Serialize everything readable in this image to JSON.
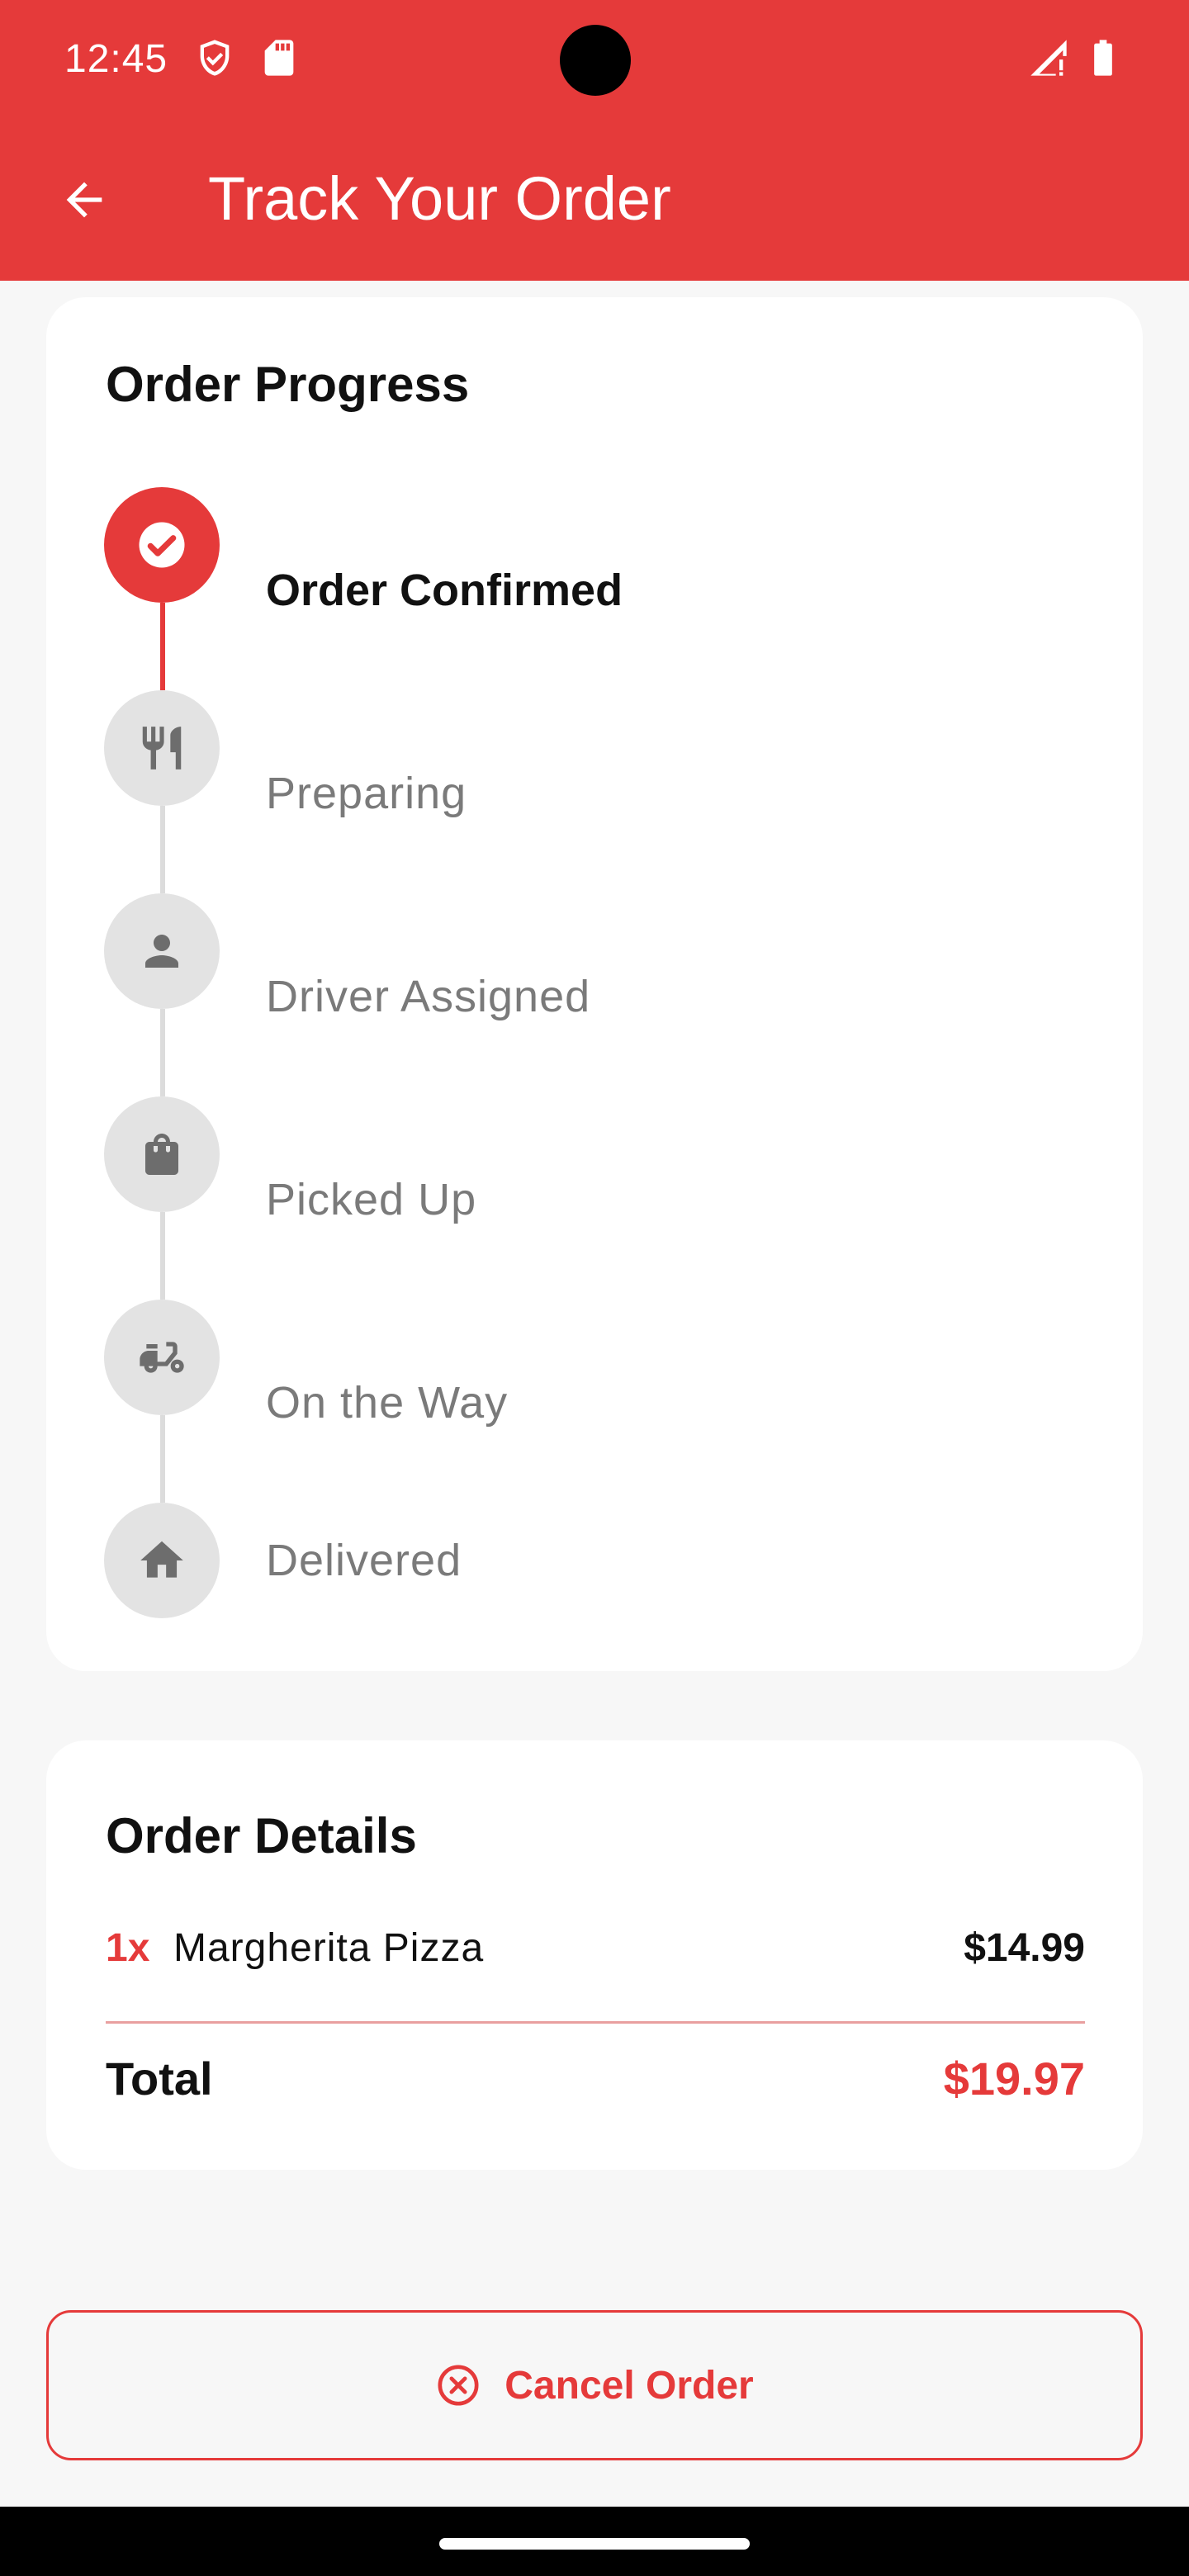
{
  "status_bar": {
    "time": "12:45",
    "icons": [
      "shield-icon",
      "sd-card-icon",
      "signal-icon",
      "battery-icon"
    ]
  },
  "app_bar": {
    "title": "Track Your Order",
    "back_icon": "arrow-back-icon"
  },
  "order_progress": {
    "title": "Order Progress",
    "steps": [
      {
        "label": "Order Confirmed",
        "icon": "check-icon",
        "done": true
      },
      {
        "label": "Preparing",
        "icon": "restaurant-icon",
        "done": false
      },
      {
        "label": "Driver Assigned",
        "icon": "person-icon",
        "done": false
      },
      {
        "label": "Picked Up",
        "icon": "shopping-bag-icon",
        "done": false
      },
      {
        "label": "On the Way",
        "icon": "scooter-icon",
        "done": false
      },
      {
        "label": "Delivered",
        "icon": "home-icon",
        "done": false
      }
    ]
  },
  "order_details": {
    "title": "Order Details",
    "items": [
      {
        "qty": "1x",
        "name": "Margherita Pizza",
        "price": "$14.99"
      }
    ],
    "total_label": "Total",
    "total_value": "$19.97"
  },
  "cancel_button": {
    "label": "Cancel Order",
    "icon": "cancel-circle-icon"
  },
  "colors": {
    "accent": "#e53a3a",
    "inactive_step": "#e3e3e3",
    "inactive_text": "#7a7a7a"
  }
}
